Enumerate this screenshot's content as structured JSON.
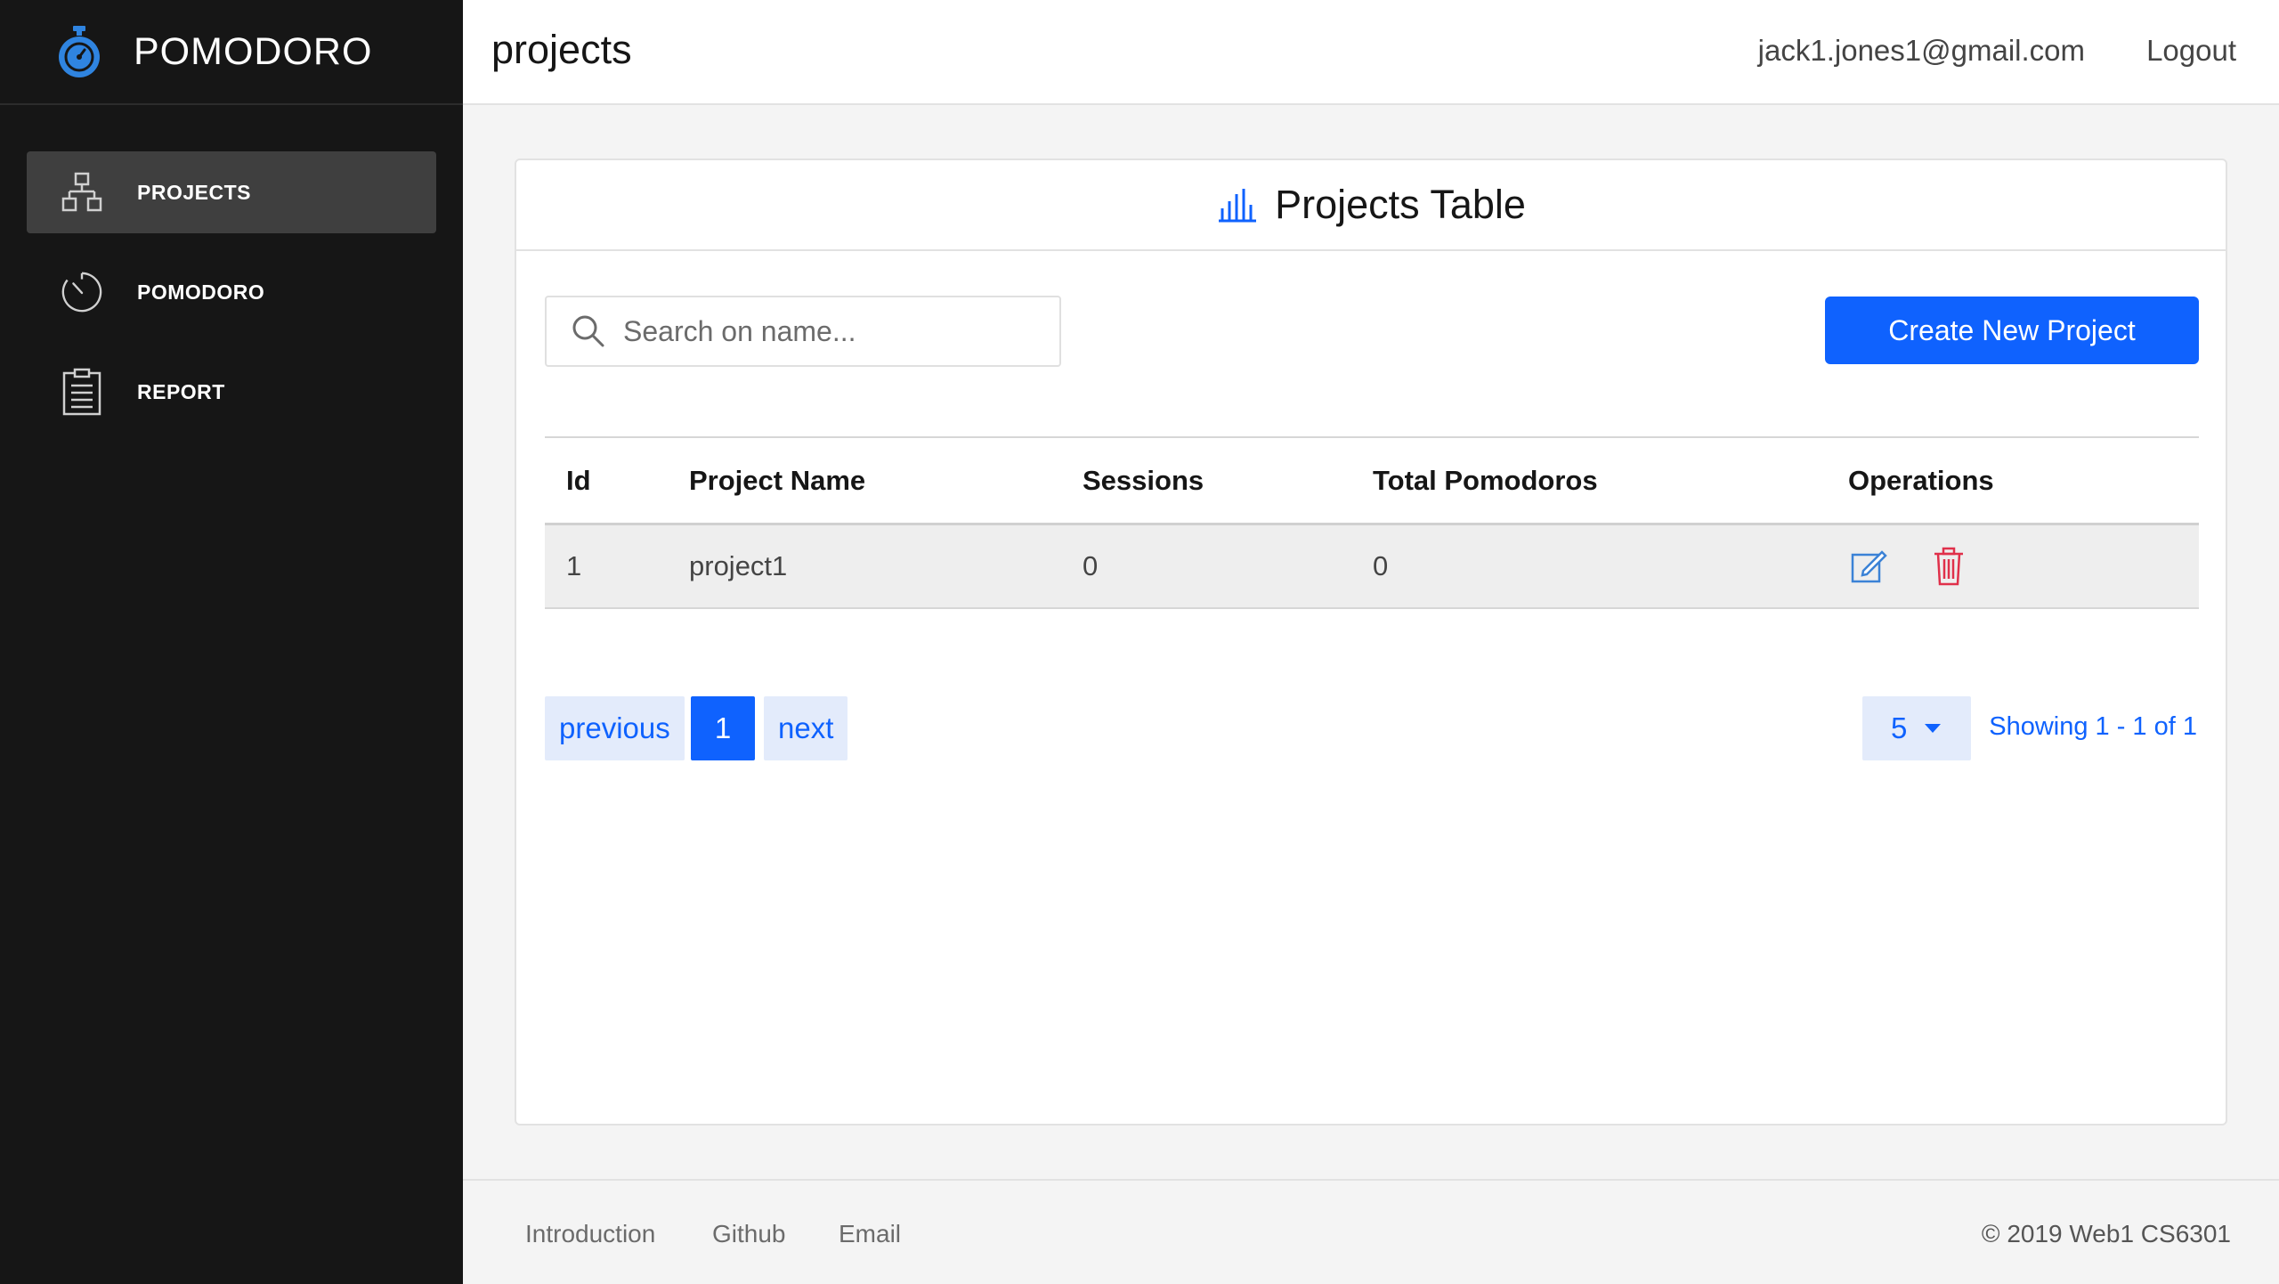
{
  "app": {
    "brand": "POMODORO",
    "brand_icon": "stopwatch-icon",
    "accent": "#0f62fe"
  },
  "sidebar": {
    "items": [
      {
        "label": "PROJECTS",
        "icon": "hierarchy-icon",
        "active": true
      },
      {
        "label": "POMODORO",
        "icon": "timer-icon",
        "active": false
      },
      {
        "label": "REPORT",
        "icon": "clipboard-icon",
        "active": false
      }
    ]
  },
  "header": {
    "title": "projects",
    "user_email": "jack1.jones1@gmail.com",
    "logout_label": "Logout"
  },
  "card": {
    "title": "Projects Table",
    "title_icon": "bar-chart-icon",
    "search": {
      "placeholder": "Search on name...",
      "value": ""
    },
    "create_button": "Create New Project"
  },
  "table": {
    "columns": [
      "Id",
      "Project Name",
      "Sessions",
      "Total Pomodoros",
      "Operations"
    ],
    "rows": [
      {
        "id": "1",
        "name": "project1",
        "sessions": "0",
        "total_pomodoros": "0",
        "operations": [
          "edit-icon",
          "delete-icon"
        ]
      }
    ]
  },
  "pagination": {
    "previous": "previous",
    "current_page": "1",
    "next": "next",
    "per_page": "5",
    "showing": "Showing 1 - 1 of 1"
  },
  "footer": {
    "links": [
      "Introduction",
      "Github",
      "Email"
    ],
    "copyright": "© 2019 Web1 CS6301"
  }
}
